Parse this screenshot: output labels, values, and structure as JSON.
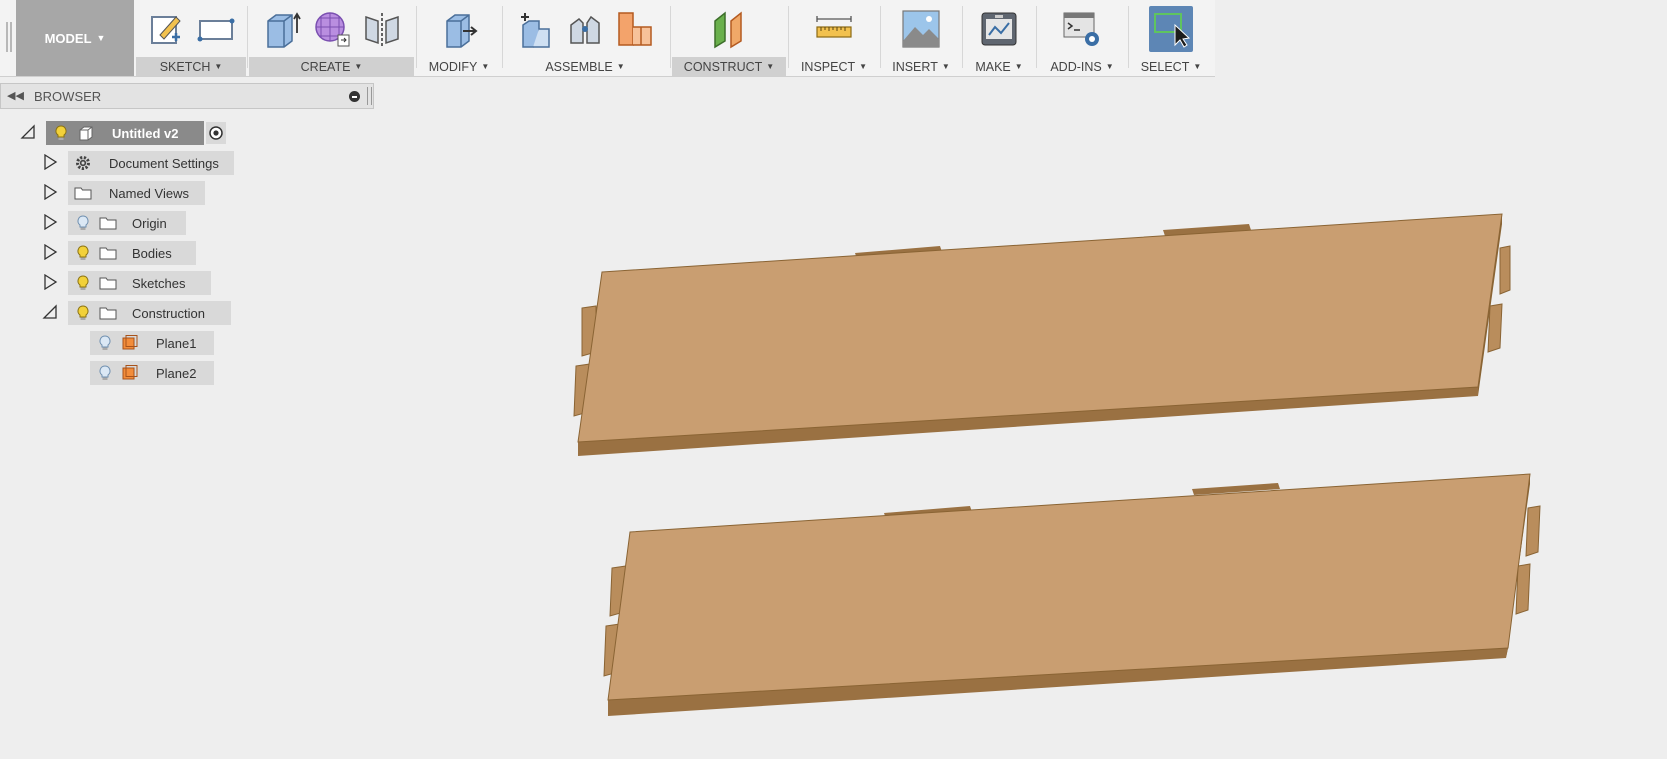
{
  "toolbar": {
    "workspace": {
      "label": "MODEL"
    },
    "groups": [
      {
        "label": "SKETCH",
        "icons": [
          "create-sketch-icon",
          "rectangle-icon"
        ]
      },
      {
        "label": "CREATE",
        "icons": [
          "extrude-icon",
          "form-icon",
          "mirror-icon"
        ]
      },
      {
        "label": "MODIFY",
        "icons": [
          "press-pull-icon"
        ]
      },
      {
        "label": "ASSEMBLE",
        "icons": [
          "new-component-icon",
          "joint-icon",
          "as-built-joint-icon"
        ]
      },
      {
        "label": "CONSTRUCT",
        "icons": [
          "offset-plane-icon"
        ]
      },
      {
        "label": "INSPECT",
        "icons": [
          "measure-icon"
        ]
      },
      {
        "label": "INSERT",
        "icons": [
          "insert-image-icon"
        ]
      },
      {
        "label": "MAKE",
        "icons": [
          "3d-print-icon"
        ]
      },
      {
        "label": "ADD-INS",
        "icons": [
          "scripts-addins-icon"
        ]
      },
      {
        "label": "SELECT",
        "icons": [
          "select-icon"
        ]
      }
    ]
  },
  "browser": {
    "title": "BROWSER",
    "root": {
      "label": "Untitled v2"
    },
    "items": [
      {
        "label": "Document Settings"
      },
      {
        "label": "Named Views"
      },
      {
        "label": "Origin"
      },
      {
        "label": "Bodies"
      },
      {
        "label": "Sketches"
      },
      {
        "label": "Construction"
      },
      {
        "label": "Plane1"
      },
      {
        "label": "Plane2"
      }
    ]
  },
  "colors": {
    "wood_top": "#c99e71",
    "wood_edge": "#9a7142",
    "wood_side": "#b98d5c",
    "select_active": "#5d86b5"
  }
}
